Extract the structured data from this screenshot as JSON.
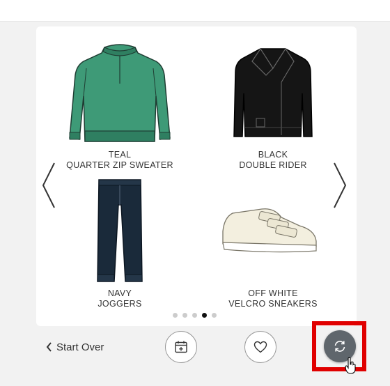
{
  "carousel": {
    "items": [
      {
        "color": "TEAL",
        "name": "QUARTER ZIP SWEATER"
      },
      {
        "color": "BLACK",
        "name": "DOUBLE RIDER"
      },
      {
        "color": "NAVY",
        "name": "JOGGERS"
      },
      {
        "color": "OFF WHITE",
        "name": "VELCRO SNEAKERS"
      }
    ],
    "pages": 5,
    "active_page": 4
  },
  "footer": {
    "start_over_label": "Start Over"
  },
  "icons": {
    "prev": "chevron-left-icon",
    "next": "chevron-right-icon",
    "calendar": "calendar-add-icon",
    "favorite": "heart-icon",
    "refresh": "refresh-icon"
  },
  "colors": {
    "highlight": "#e00000",
    "refresh_button": "#5f666c",
    "active_dot": "#111111"
  }
}
